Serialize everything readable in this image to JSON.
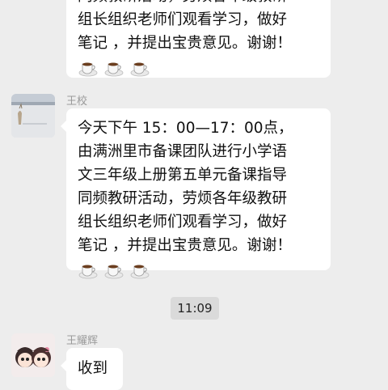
{
  "messages": [
    {
      "sender": "",
      "lines": [
        "同频教研活动，劳烦各年级教研",
        "组长组织老师们观看学习，做好",
        "笔记 ，并提出宝贵意见。谢谢！"
      ],
      "emoji": [
        "coffee-cup",
        "coffee-cup",
        "coffee-cup"
      ]
    },
    {
      "sender": "王校",
      "lines": [
        "今天下午 15：00—17：00点，",
        "由满洲里市备课团队进行小学语",
        "文三年级上册第五单元备课指导",
        "同频教研活动，劳烦各年级教研",
        "组长组织老师们观看学习，做好",
        "笔记 ，并提出宝贵意见。谢谢！"
      ],
      "emoji": [
        "coffee-cup",
        "coffee-cup",
        "coffee-cup"
      ]
    },
    {
      "sender": "王耀辉",
      "text": "收到"
    }
  ],
  "time_separator": "11:09",
  "colors": {
    "background": "#ededed",
    "bubble": "#ffffff",
    "sender_name": "#9a9a9a",
    "time_badge": "#dadada"
  }
}
